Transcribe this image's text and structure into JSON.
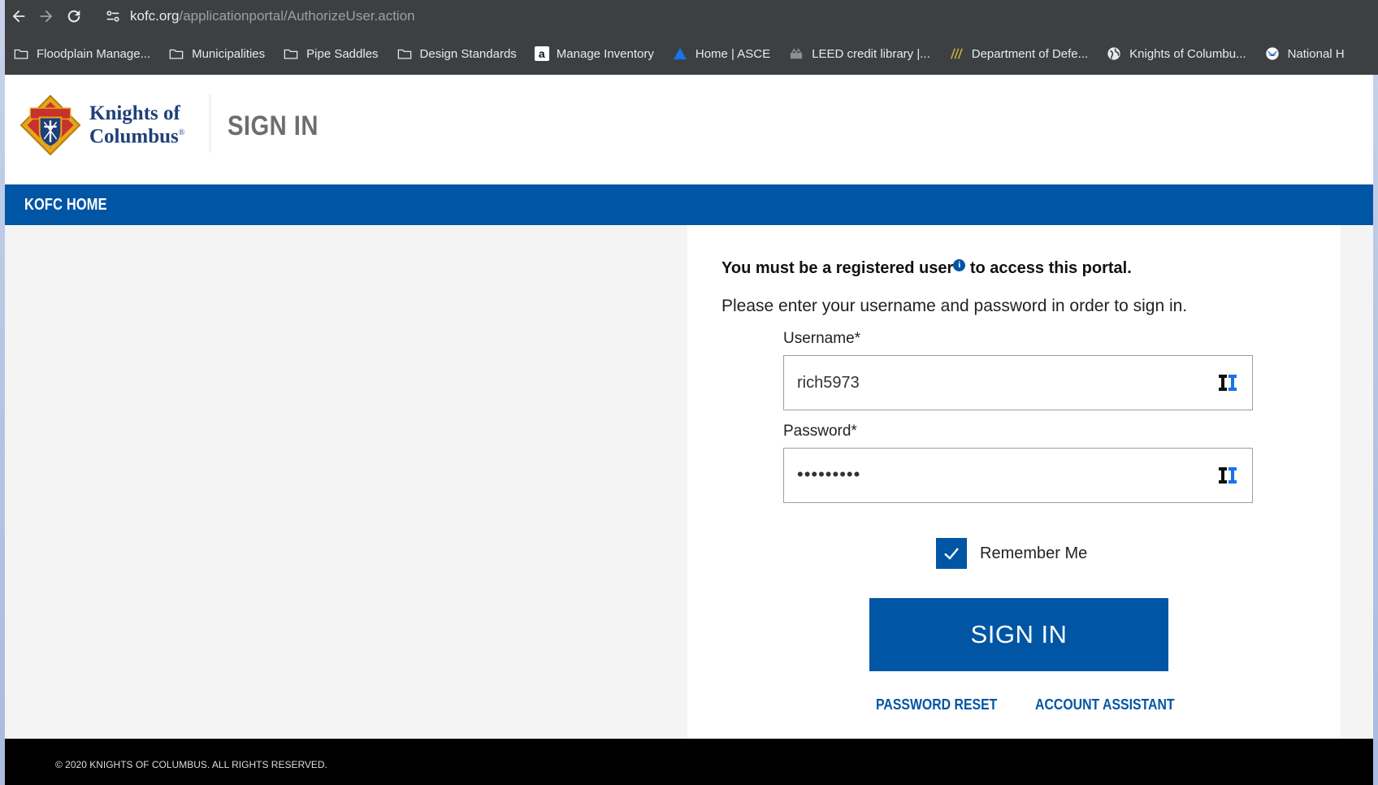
{
  "browser": {
    "url_domain": "kofc.org",
    "url_path": "/applicationportal/AuthorizeUser.action",
    "bookmarks": [
      {
        "label": "Floodplain Manage...",
        "icon": "folder-icon"
      },
      {
        "label": "Municipalities",
        "icon": "folder-icon"
      },
      {
        "label": "Pipe Saddles",
        "icon": "folder-icon"
      },
      {
        "label": "Design Standards",
        "icon": "folder-icon"
      },
      {
        "label": "Manage Inventory",
        "icon": "amazon-icon"
      },
      {
        "label": "Home | ASCE",
        "icon": "asce-icon"
      },
      {
        "label": "LEED credit library |...",
        "icon": "leed-icon"
      },
      {
        "label": "Department of Defe...",
        "icon": "dod-icon"
      },
      {
        "label": "Knights of Columbu...",
        "icon": "globe-icon"
      },
      {
        "label": "National H",
        "icon": "noaa-icon"
      }
    ]
  },
  "header": {
    "logo_line1": "Knights of",
    "logo_line2": "Columbus",
    "logo_mark": "®",
    "title": "SIGN IN"
  },
  "nav": {
    "home_link": "KOFC HOME"
  },
  "form": {
    "notice_before": "You must be a registered user",
    "notice_info_glyph": "i",
    "notice_after": " to access this portal.",
    "instructions": "Please enter your username and password in order to sign in.",
    "username_label": "Username*",
    "username_value": "rich5973",
    "password_label": "Password*",
    "password_value": "•••••••••",
    "remember_label": "Remember Me",
    "remember_checked": true,
    "submit_label": "SIGN IN",
    "password_reset_link": "PASSWORD RESET",
    "account_assistant_link": "ACCOUNT ASSISTANT"
  },
  "footer": {
    "copyright": "© 2020 KNIGHTS OF COLUMBUS. ALL RIGHTS RESERVED."
  },
  "colors": {
    "primary_blue": "#0055a5",
    "chrome_dark": "#3c4043",
    "footer_black": "#000000",
    "logo_navy": "#1f3f79"
  }
}
